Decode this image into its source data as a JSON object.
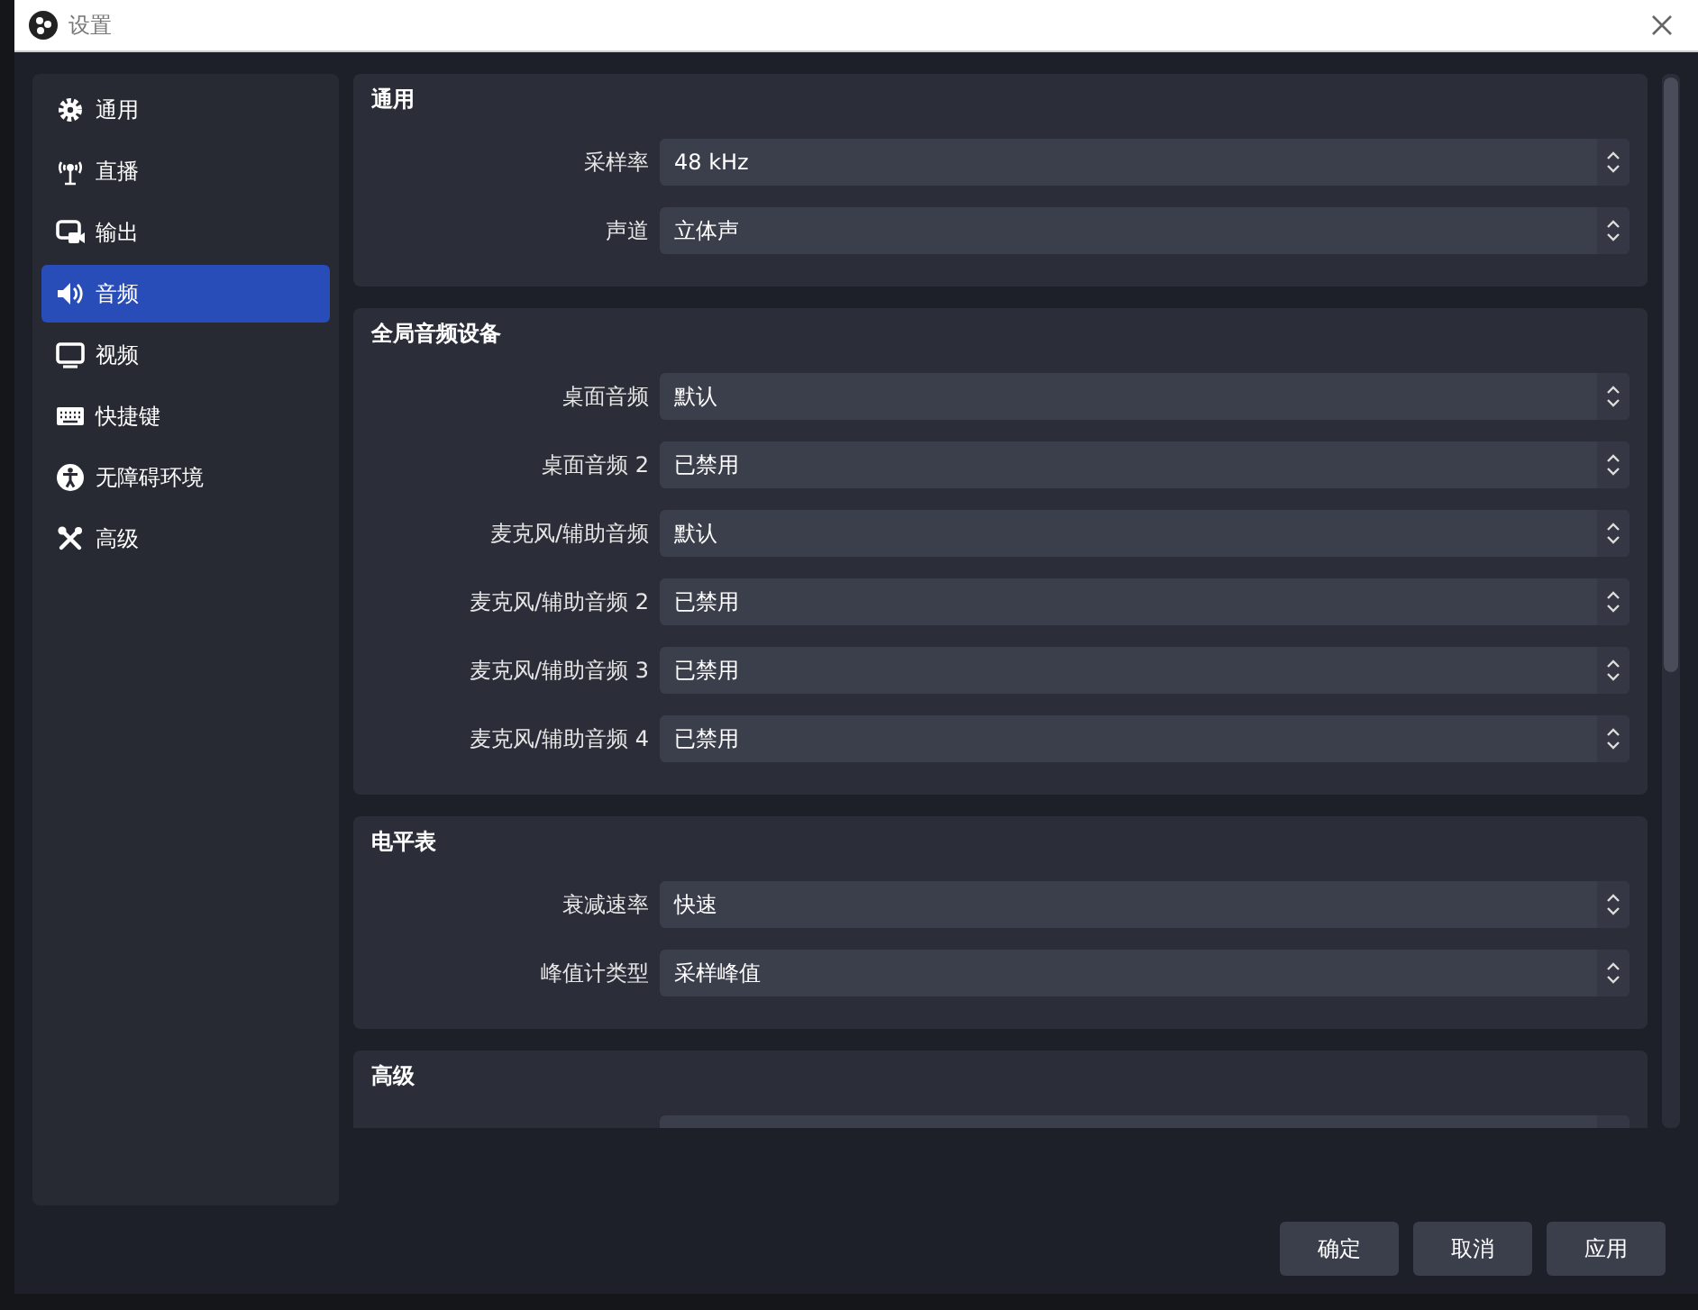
{
  "window": {
    "title": "设置"
  },
  "sidebar": {
    "items": [
      {
        "label": "通用",
        "selected": false
      },
      {
        "label": "直播",
        "selected": false
      },
      {
        "label": "输出",
        "selected": false
      },
      {
        "label": "音频",
        "selected": true
      },
      {
        "label": "视频",
        "selected": false
      },
      {
        "label": "快捷键",
        "selected": false
      },
      {
        "label": "无障碍环境",
        "selected": false
      },
      {
        "label": "高级",
        "selected": false
      }
    ]
  },
  "groups": [
    {
      "title": "通用",
      "rows": [
        {
          "label": "采样率",
          "value": "48 kHz"
        },
        {
          "label": "声道",
          "value": "立体声"
        }
      ]
    },
    {
      "title": "全局音频设备",
      "rows": [
        {
          "label": "桌面音频",
          "value": "默认"
        },
        {
          "label": "桌面音频 2",
          "value": "已禁用"
        },
        {
          "label": "麦克风/辅助音频",
          "value": "默认"
        },
        {
          "label": "麦克风/辅助音频 2",
          "value": "已禁用"
        },
        {
          "label": "麦克风/辅助音频 3",
          "value": "已禁用"
        },
        {
          "label": "麦克风/辅助音频 4",
          "value": "已禁用"
        }
      ]
    },
    {
      "title": "电平表",
      "rows": [
        {
          "label": "衰减速率",
          "value": "快速"
        },
        {
          "label": "峰值计类型",
          "value": "采样峰值"
        }
      ]
    },
    {
      "title": "高级",
      "rows": [
        {}
      ]
    }
  ],
  "buttons": [
    "确定",
    "取消",
    "应用"
  ]
}
